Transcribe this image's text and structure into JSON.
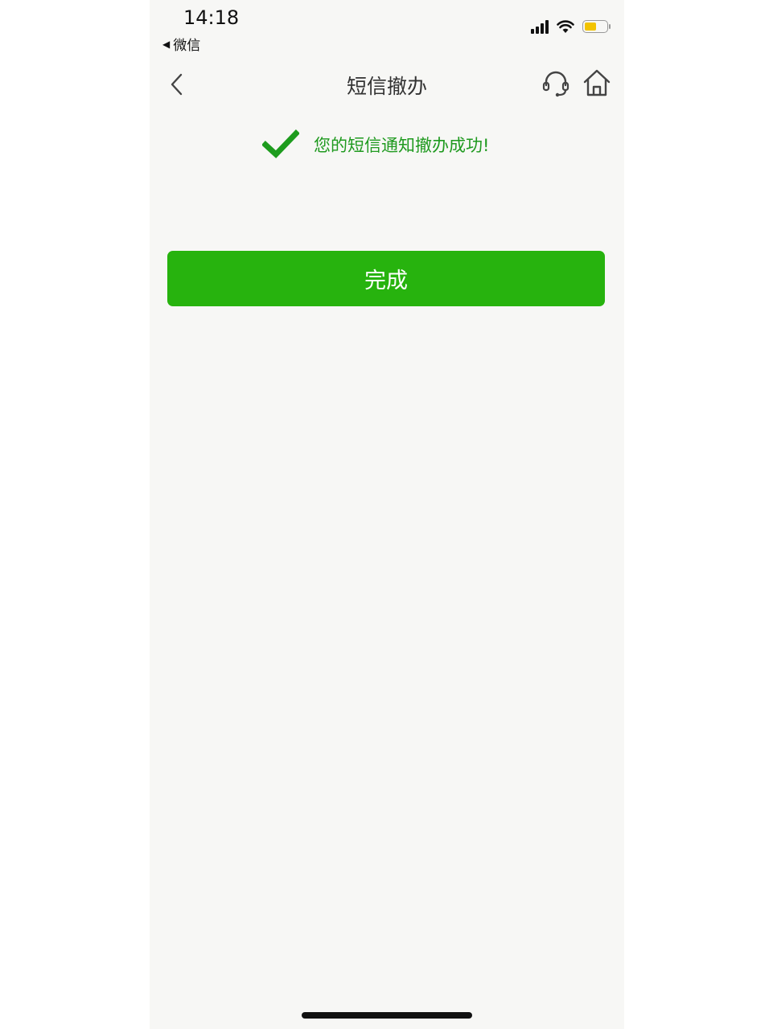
{
  "status_bar": {
    "time": "14:18",
    "back_app_arrow": "◀",
    "back_app_label": "微信",
    "battery_color": "#f2c300"
  },
  "navbar": {
    "title": "短信撤办",
    "back_icon": "chevron-left-icon",
    "service_icon": "headset-icon",
    "home_icon": "home-icon"
  },
  "message": {
    "icon": "checkmark-icon",
    "text": "您的短信通知撤办成功!",
    "color": "#1f9a1f"
  },
  "actions": {
    "done_label": "完成",
    "button_color": "#27b30e"
  }
}
